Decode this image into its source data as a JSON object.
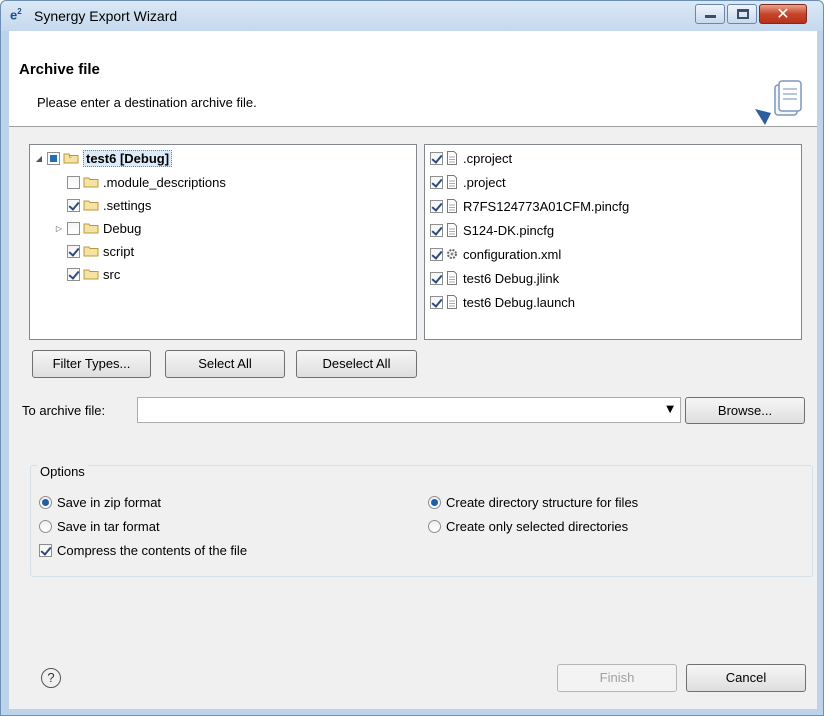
{
  "window": {
    "title": "Synergy Export Wizard",
    "app_icon": "e²"
  },
  "header": {
    "title": "Archive file",
    "description": "Please enter a destination archive file."
  },
  "tree": {
    "root": {
      "label": "test6 [Debug]"
    },
    "children": [
      {
        "label": ".module_descriptions",
        "checked": false
      },
      {
        "label": ".settings",
        "checked": true
      },
      {
        "label": "Debug",
        "checked": false
      },
      {
        "label": "script",
        "checked": true
      },
      {
        "label": "src",
        "checked": true
      }
    ]
  },
  "files": [
    {
      "label": ".cproject",
      "icon": "file-icon"
    },
    {
      "label": ".project",
      "icon": "file-icon"
    },
    {
      "label": "R7FS124773A01CFM.pincfg",
      "icon": "file-icon"
    },
    {
      "label": "S124-DK.pincfg",
      "icon": "file-icon"
    },
    {
      "label": "configuration.xml",
      "icon": "gear-icon"
    },
    {
      "label": "test6 Debug.jlink",
      "icon": "file-icon"
    },
    {
      "label": "test6 Debug.launch",
      "icon": "file-icon"
    }
  ],
  "buttons": {
    "filter": "Filter Types...",
    "select_all": "Select All",
    "deselect_all": "Deselect All",
    "browse": "Browse...",
    "finish": "Finish",
    "cancel": "Cancel"
  },
  "archive": {
    "label": "To archive file:",
    "value": ""
  },
  "options": {
    "title": "Options",
    "zip": "Save in zip format",
    "tar": "Save in tar format",
    "compress": "Compress the contents of the file",
    "create_structure": "Create directory structure for files",
    "create_selected": "Create only selected directories"
  },
  "help": {
    "glyph": "?"
  }
}
